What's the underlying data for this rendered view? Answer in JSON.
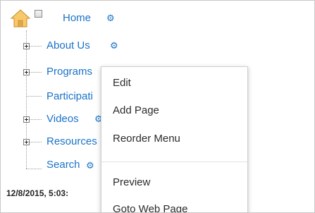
{
  "tree": {
    "root": {
      "label": "Home"
    },
    "items": [
      {
        "label": "About Us"
      },
      {
        "label": "Programs"
      },
      {
        "label": "Participati"
      },
      {
        "label": "Videos"
      },
      {
        "label": "Resources"
      },
      {
        "label": "Search"
      }
    ]
  },
  "status": {
    "text": "12/8/2015, 5:03:"
  },
  "context_menu": {
    "items": [
      "Edit",
      "Add Page",
      "Reorder Menu",
      "Preview",
      "Goto Web Page"
    ]
  },
  "colors": {
    "link": "#1a73c9",
    "home_icon": "#f2b84b"
  }
}
